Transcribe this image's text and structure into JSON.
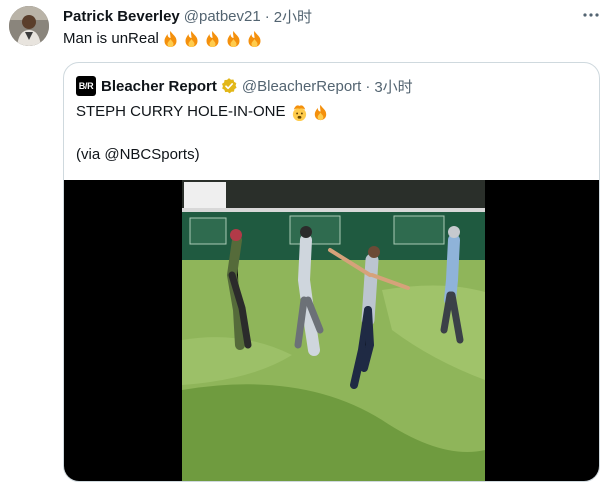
{
  "tweet": {
    "author_name": "Patrick Beverley",
    "author_handle": "@patbev21",
    "separator": "·",
    "time": "2小时",
    "text": "Man is unReal",
    "text_emoji": [
      "fire-icon",
      "fire-icon",
      "fire-icon",
      "fire-icon",
      "fire-icon"
    ],
    "more_icon": "more-icon"
  },
  "quoted_tweet": {
    "logo_text": "B/R",
    "author_name": "Bleacher Report",
    "verified_icon": "verified-gold-icon",
    "author_handle": "@BleacherReport",
    "separator": "·",
    "time": "3小时",
    "line1": "STEPH CURRY HOLE-IN-ONE",
    "line1_emoji": [
      "exploding-head-icon",
      "fire-icon"
    ],
    "line2": "(via @NBCSports)",
    "media": "golf-course-video"
  },
  "colors": {
    "text_primary": "#0f1419",
    "text_secondary": "#536471",
    "border": "#cfd9de",
    "verified": "#e2b719",
    "fire": "#f4900c"
  }
}
